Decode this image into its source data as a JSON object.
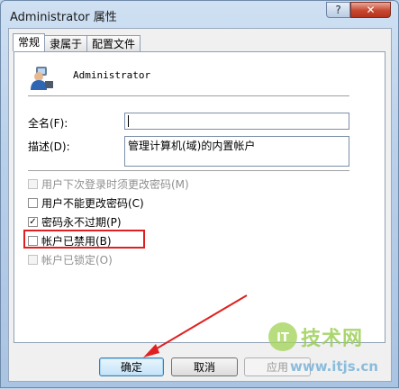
{
  "window": {
    "title": "Administrator 属性",
    "help_label": "?",
    "close_label": "✕"
  },
  "tabs": [
    {
      "label": "常规"
    },
    {
      "label": "隶属于"
    },
    {
      "label": "配置文件"
    }
  ],
  "user": {
    "name": "Administrator",
    "avatar_icon": "user-icon"
  },
  "fields": {
    "fullname_label": "全名(F):",
    "fullname_value": "",
    "description_label": "描述(D):",
    "description_value": "管理计算机(域)的内置帐户"
  },
  "checkboxes": [
    {
      "label": "用户下次登录时须更改密码(M)",
      "checked": false,
      "disabled": true
    },
    {
      "label": "用户不能更改密码(C)",
      "checked": false,
      "disabled": false
    },
    {
      "label": "密码永不过期(P)",
      "checked": true,
      "disabled": false
    },
    {
      "label": "帐户已禁用(B)",
      "checked": false,
      "disabled": false
    },
    {
      "label": "帐户已锁定(O)",
      "checked": false,
      "disabled": true
    }
  ],
  "buttons": {
    "ok": "确定",
    "cancel": "取消",
    "apply": "应用"
  },
  "annotation": {
    "highlight_color": "#e02020",
    "arrow_color": "#e02020"
  },
  "watermark": {
    "name": "技术网",
    "url": "www.itjs.cn",
    "logo_text": "IT"
  }
}
